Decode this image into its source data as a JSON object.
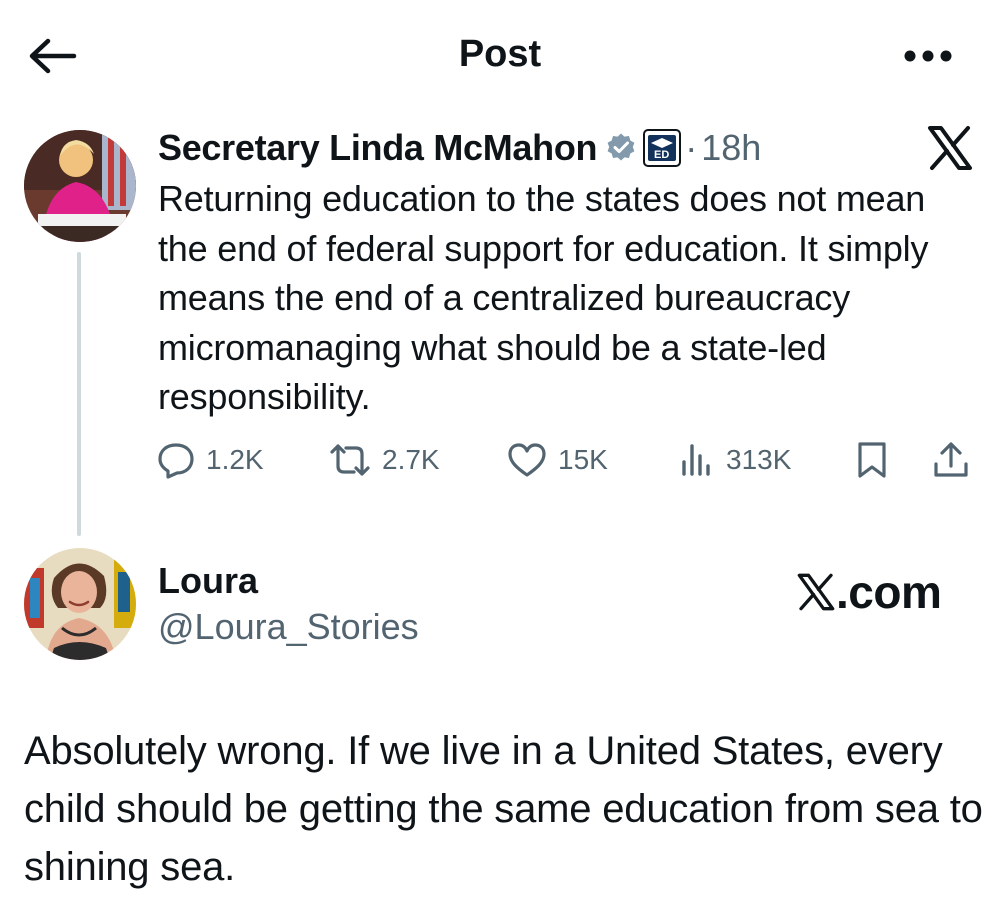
{
  "header": {
    "title": "Post",
    "back_icon": "arrow-left-icon",
    "more_icon": "more-horizontal-icon"
  },
  "original_post": {
    "author_name": "Secretary Linda McMahon",
    "verified_icon": "verified-badge-icon",
    "affiliation_icon": "department-of-education-badge-icon",
    "separator": "·",
    "time": "18h",
    "brand_icon": "x-logo-icon",
    "text": "Returning education to the states does not mean the end of federal support for education. It simply means the end of a centralized bureaucracy micromanaging what should be a state-led responsibility.",
    "actions": {
      "replies": "1.2K",
      "reposts": "2.7K",
      "likes": "15K",
      "views": "313K"
    }
  },
  "reply_post": {
    "author_name": "Loura",
    "handle": "@Loura_Stories",
    "watermark": ".com",
    "text": "Absolutely wrong. If we live in a United States, every child should be getting the same education from sea to shining sea."
  },
  "colors": {
    "text": "#0f1419",
    "secondary": "#536471",
    "thread_line": "#cfd9de",
    "verified": "#829aab"
  }
}
